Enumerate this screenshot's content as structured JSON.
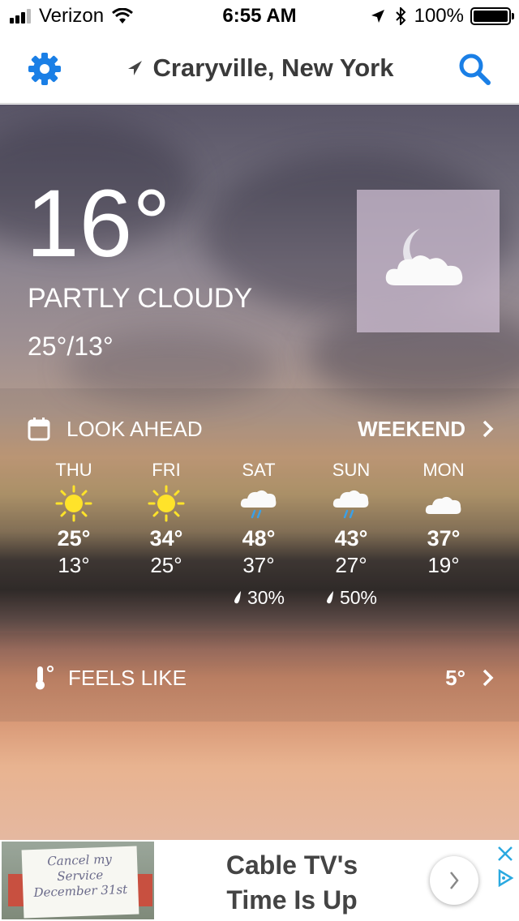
{
  "status_bar": {
    "carrier": "Verizon",
    "time": "6:55 AM",
    "battery": "100%"
  },
  "navbar": {
    "location": "Craryville, New York"
  },
  "current": {
    "temperature": "16°",
    "condition": "PARTLY CLOUDY",
    "hi_lo": "25°/13°"
  },
  "look_ahead": {
    "title": "LOOK AHEAD",
    "link": "WEEKEND",
    "days": [
      {
        "name": "THU",
        "hi": "25°",
        "lo": "13°",
        "precip": "",
        "icon": "sun-icon"
      },
      {
        "name": "FRI",
        "hi": "34°",
        "lo": "25°",
        "precip": "",
        "icon": "sun-icon"
      },
      {
        "name": "SAT",
        "hi": "48°",
        "lo": "37°",
        "precip": "30%",
        "icon": "rain-cloud-icon"
      },
      {
        "name": "SUN",
        "hi": "43°",
        "lo": "27°",
        "precip": "50%",
        "icon": "rain-cloud-icon"
      },
      {
        "name": "MON",
        "hi": "37°",
        "lo": "19°",
        "precip": "",
        "icon": "cloud-icon"
      }
    ]
  },
  "feels_like": {
    "label": "FEELS LIKE",
    "value": "5°"
  },
  "ad": {
    "headline_line1": "Cable TV's",
    "headline_line2": "Time Is Up",
    "sign_line1": "Cancel my",
    "sign_line2": "Service",
    "sign_line3": "December 31st"
  },
  "colors": {
    "accent": "#1a7fe6",
    "ad_choice": "#2aa9e0"
  }
}
